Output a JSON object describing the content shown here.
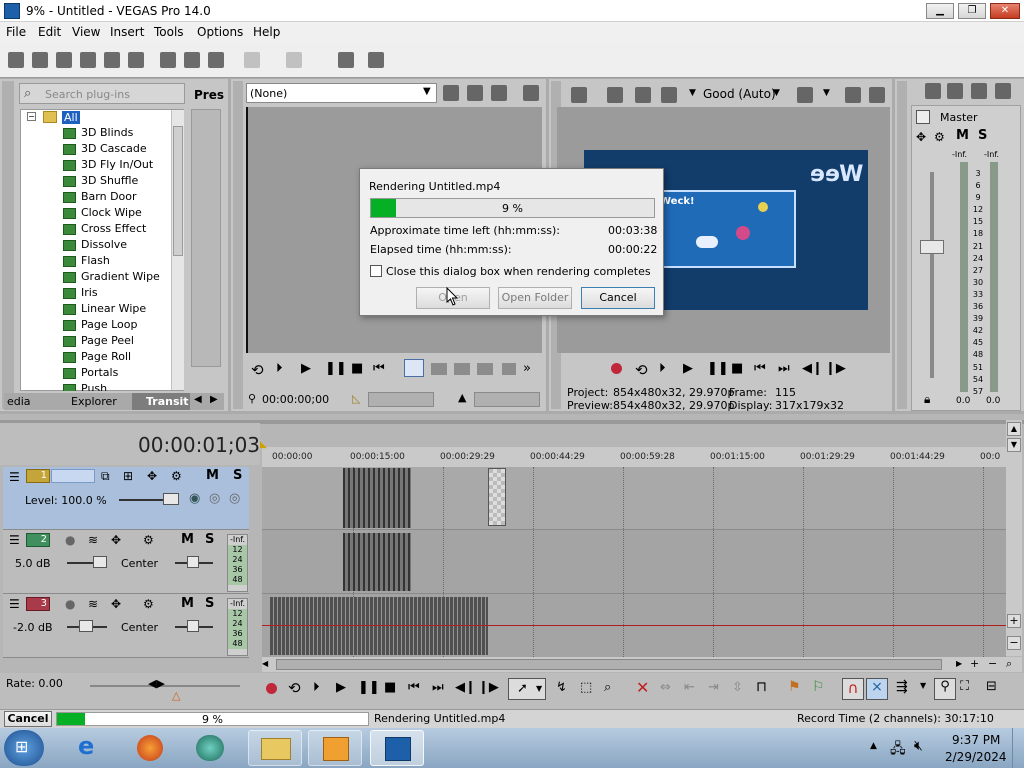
{
  "window": {
    "title": "9% - Untitled - VEGAS Pro 14.0",
    "minimize": "▁",
    "restore": "❐",
    "close": "✕"
  },
  "menu": [
    "File",
    "Edit",
    "View",
    "Insert",
    "Tools",
    "Options",
    "Help"
  ],
  "explorer": {
    "search_placeholder": "Search plug-ins",
    "pres_label": "Pres",
    "root": "All",
    "items": [
      "3D Blinds",
      "3D Cascade",
      "3D Fly In/Out",
      "3D Shuffle",
      "Barn Door",
      "Clock Wipe",
      "Cross Effect",
      "Dissolve",
      "Flash",
      "Gradient Wipe",
      "Iris",
      "Linear Wipe",
      "Page Loop",
      "Page Peel",
      "Page Roll",
      "Portals",
      "Push"
    ],
    "tabs": [
      "edia",
      "Explorer",
      "Transit"
    ]
  },
  "trimmer": {
    "dropdown": "(None)",
    "timecode": "00:00:00;00"
  },
  "preview": {
    "quality": "Good (Auto)",
    "project_label": "Project:",
    "project_value": "854x480x32, 29.970p",
    "preview_label": "Preview:",
    "preview_value": "854x480x32, 29.970p",
    "frame_label": "Frame:",
    "frame_value": "115",
    "display_label": "Display:",
    "display_value": "317x179x32",
    "video_text1": "Wee",
    "video_text2": "Weck!"
  },
  "mixer": {
    "title": "Master",
    "peak_left": "-Inf.",
    "peak_right": "-Inf.",
    "scale": [
      "3",
      "6",
      "9",
      "12",
      "15",
      "18",
      "21",
      "24",
      "27",
      "30",
      "33",
      "36",
      "39",
      "42",
      "45",
      "48",
      "51",
      "54",
      "57"
    ],
    "bottom_left": "0.0",
    "bottom_right": "0.0"
  },
  "render_dialog": {
    "title": "Rendering Untitled.mp4",
    "progress_percent": 9,
    "progress_text": "9 %",
    "time_left_label": "Approximate time left (hh:mm:ss):",
    "time_left_value": "00:03:38",
    "elapsed_label": "Elapsed time (hh:mm:ss):",
    "elapsed_value": "00:00:22",
    "checkbox_label": "Close this dialog box when rendering completes",
    "open_button": "Open",
    "open_folder_button": "Open Folder",
    "cancel_button": "Cancel"
  },
  "timeline": {
    "timecode": "00:00:01;03",
    "ruler": [
      "00:00:00",
      "00:00:15:00",
      "00:00:29:29",
      "00:00:44:29",
      "00:00:59:28",
      "00:01:15:00",
      "00:01:29:29",
      "00:01:44:29",
      "00:0"
    ],
    "tracks": [
      {
        "num": "1",
        "level": "Level: 100.0 %",
        "color": "#c4a53a"
      },
      {
        "num": "2",
        "vol": "5.0 dB",
        "pan": "Center",
        "color": "#3f8f5f",
        "meter": [
          "-Inf.",
          "12",
          "24",
          "36",
          "48"
        ]
      },
      {
        "num": "3",
        "vol": "-2.0 dB",
        "pan": "Center",
        "color": "#a83a4a",
        "meter": [
          "-Inf.",
          "12",
          "24",
          "36",
          "48"
        ]
      }
    ],
    "rate": "Rate: 0.00"
  },
  "status": {
    "cancel": "Cancel",
    "percent": 9,
    "percent_text": "9 %",
    "message": "Rendering Untitled.mp4",
    "record_time": "Record Time (2 channels): 30:17:10"
  },
  "taskbar": {
    "time": "9:37 PM",
    "date": "2/29/2024"
  }
}
